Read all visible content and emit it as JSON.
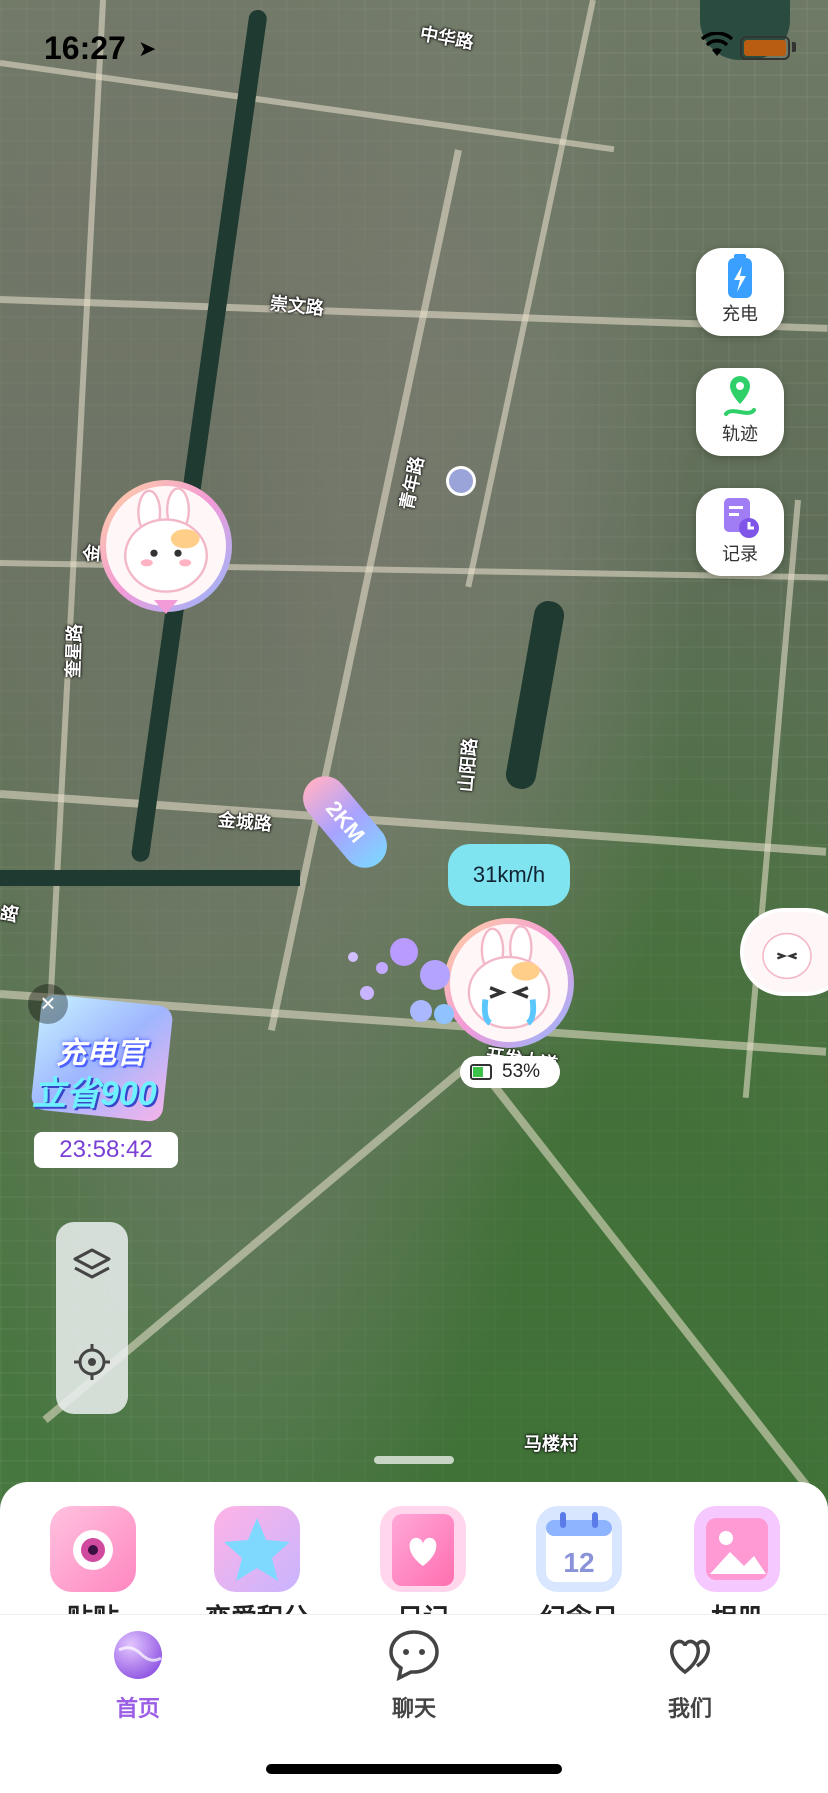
{
  "status_bar": {
    "time": "16:27"
  },
  "map": {
    "roads": [
      "中华路",
      "崇文路",
      "青年路",
      "山阳路",
      "金城路",
      "奎星路",
      "路",
      "金",
      "马楼村"
    ],
    "partial_road_label": "开发大道"
  },
  "side_buttons": [
    {
      "label": "充电",
      "icon": "battery-charge-icon"
    },
    {
      "label": "轨迹",
      "icon": "track-pin-icon"
    },
    {
      "label": "记录",
      "icon": "record-calendar-icon"
    }
  ],
  "speed_badge": "31km/h",
  "distance_pill": "2KM",
  "partner_battery": "53%",
  "promo": {
    "title": "充电官",
    "subtitle": "立省900",
    "countdown": "23:58:42",
    "close": "×"
  },
  "functions": [
    {
      "label": "贴贴",
      "icon": "camera-icon"
    },
    {
      "label": "恋爱积分",
      "icon": "star-icon"
    },
    {
      "label": "日记",
      "icon": "heart-book-icon"
    },
    {
      "label": "纪念日",
      "icon": "calendar-12-icon"
    },
    {
      "label": "相册",
      "icon": "photo-album-icon"
    }
  ],
  "tabs": [
    {
      "label": "首页",
      "active": true
    },
    {
      "label": "聊天",
      "active": false
    },
    {
      "label": "我们",
      "active": false
    }
  ],
  "colors": {
    "accent": "#9b5de5",
    "inactive": "#444444",
    "speed_bg": "#7fe3f0"
  }
}
